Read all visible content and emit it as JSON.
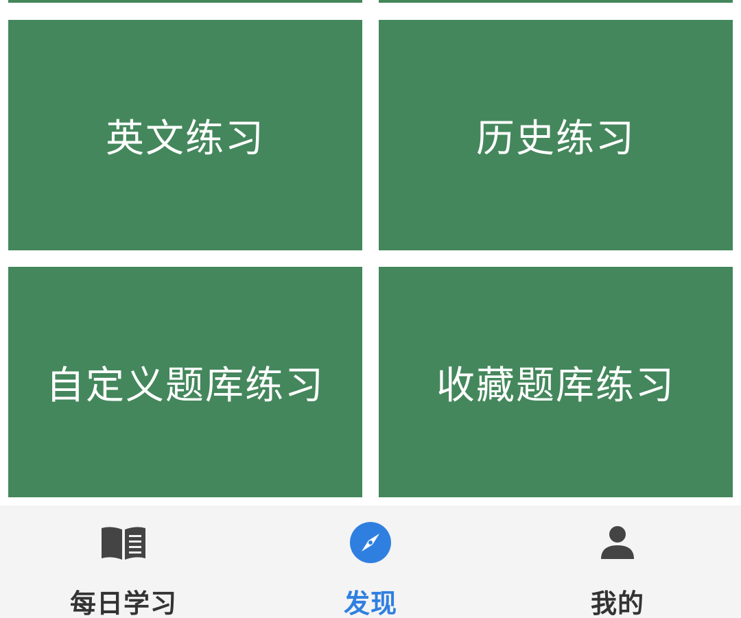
{
  "tiles": [
    {
      "label": "英文练习"
    },
    {
      "label": "历史练习"
    },
    {
      "label": "自定义题库练习"
    },
    {
      "label": "收藏题库练习"
    }
  ],
  "tabbar": {
    "items": [
      {
        "label": "每日学习",
        "icon": "book-icon",
        "active": false
      },
      {
        "label": "发现",
        "icon": "compass-icon",
        "active": true
      },
      {
        "label": "我的",
        "icon": "person-icon",
        "active": false
      }
    ]
  },
  "colors": {
    "tile_green": "#44875c",
    "tab_active": "#2f7fe0",
    "tab_inactive": "#333333",
    "tabbar_bg": "#f4f4f4"
  }
}
